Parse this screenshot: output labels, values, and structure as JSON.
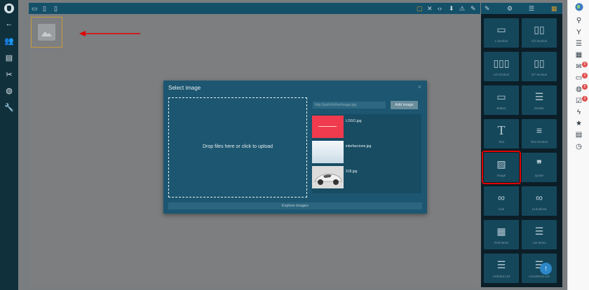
{
  "left_sidebar": {
    "items": [
      {
        "icon": "back-arrow-icon",
        "glyph": "←"
      },
      {
        "icon": "users-icon",
        "glyph": "👥"
      },
      {
        "icon": "address-book-icon",
        "glyph": "▤"
      },
      {
        "icon": "tools-icon",
        "glyph": "✂"
      },
      {
        "icon": "globe-icon",
        "glyph": "◍"
      },
      {
        "icon": "wrench-icon",
        "glyph": "🔧"
      }
    ]
  },
  "editor_toolbar": {
    "left_icons": [
      "desktop-icon",
      "tablet-icon",
      "mobile-icon"
    ],
    "right_icons": [
      "square-icon",
      "fullscreen-icon",
      "code-icon",
      "download-icon",
      "warning-icon",
      "edit-icon"
    ]
  },
  "panel_toolbar": {
    "icons": [
      "brush-icon",
      "gear-icon",
      "menu-icon",
      "grid-icon"
    ]
  },
  "blocks": [
    {
      "label": "1 Section",
      "icon": "one-section-icon"
    },
    {
      "label": "1/2 Section",
      "icon": "half-section-icon"
    },
    {
      "label": "1/3 Section",
      "icon": "third-section-icon"
    },
    {
      "label": "3/7 Section",
      "icon": "three-seventh-section-icon"
    },
    {
      "label": "Button",
      "icon": "button-icon"
    },
    {
      "label": "Divider",
      "icon": "divider-icon"
    },
    {
      "label": "Text",
      "icon": "text-icon"
    },
    {
      "label": "Text Section",
      "icon": "text-section-icon"
    },
    {
      "label": "Image",
      "icon": "image-icon"
    },
    {
      "label": "Quote",
      "icon": "quote-icon"
    },
    {
      "label": "Link",
      "icon": "link-icon"
    },
    {
      "label": "Link Block",
      "icon": "link-block-icon"
    },
    {
      "label": "Grid Items",
      "icon": "grid-items-icon"
    },
    {
      "label": "List Items",
      "icon": "list-items-icon"
    },
    {
      "label": "Unlisted List",
      "icon": "unlisted-list-icon"
    },
    {
      "label": "Unordered List",
      "icon": "unordered-list-icon"
    }
  ],
  "modal": {
    "title": "Select image",
    "close": "×",
    "dropzone_text": "Drop files here or click to upload",
    "path_placeholder": "http://path/to/the/image.jpg",
    "add_image_label": "Add image",
    "assets": [
      {
        "name": "LOGO.jpg",
        "thumb_color": "#f03a4d"
      },
      {
        "name": "interfaccione.jpg",
        "thumb_color": "#e8eff4"
      },
      {
        "name": "918.jpg",
        "thumb_color": "#dcdcdc"
      }
    ],
    "explore_label": "Explore images"
  },
  "right_bar": {
    "icons": [
      {
        "icon": "search-icon",
        "glyph": "⚲"
      },
      {
        "icon": "fork-icon",
        "glyph": "Y"
      },
      {
        "icon": "list-icon",
        "glyph": "☰"
      },
      {
        "icon": "calendar-icon",
        "glyph": "▦"
      },
      {
        "icon": "mail-icon",
        "glyph": "✉",
        "badge": "0"
      },
      {
        "icon": "chat-icon",
        "glyph": "▭",
        "badge": "2"
      },
      {
        "icon": "globe-icon",
        "glyph": "◍",
        "badge": "5"
      },
      {
        "icon": "check-icon",
        "glyph": "☑",
        "badge": "3"
      },
      {
        "icon": "bolt-icon",
        "glyph": "ϟ"
      },
      {
        "icon": "star-icon",
        "glyph": "★"
      },
      {
        "icon": "document-icon",
        "glyph": "▤"
      },
      {
        "icon": "timer-icon",
        "glyph": "◷"
      }
    ]
  },
  "colors": {
    "accent_highlight": "#e00000",
    "toolbar": "#155069",
    "sidebar": "#10303c",
    "scroll_button": "#2c87c7"
  }
}
